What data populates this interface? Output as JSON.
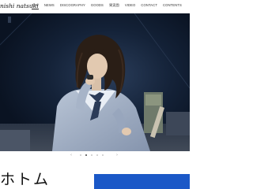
{
  "header": {
    "brand": "nishi natsuki",
    "nav": [
      {
        "label": "TOP",
        "id": "top",
        "active": true
      },
      {
        "label": "NEWS",
        "id": "news",
        "active": false
      },
      {
        "label": "DISCOGRAPHY",
        "id": "discography",
        "active": false
      },
      {
        "label": "GOODS",
        "id": "goods",
        "active": false
      },
      {
        "label": "果実園",
        "id": "kajitsuen",
        "active": false
      },
      {
        "label": "VIDEO",
        "id": "video",
        "active": false
      },
      {
        "label": "CONTACT",
        "id": "contact",
        "active": false
      },
      {
        "label": "CONTENTS",
        "id": "contents",
        "active": false
      }
    ]
  },
  "carousel": {
    "prev_arrow": "‹",
    "next_arrow": "›",
    "slide_count": 5,
    "active_index": 1
  },
  "lower": {
    "title_partial": "ホトム"
  },
  "colors": {
    "hero_bg": "#0d1a2c",
    "accent_blue": "#1b58c7"
  }
}
